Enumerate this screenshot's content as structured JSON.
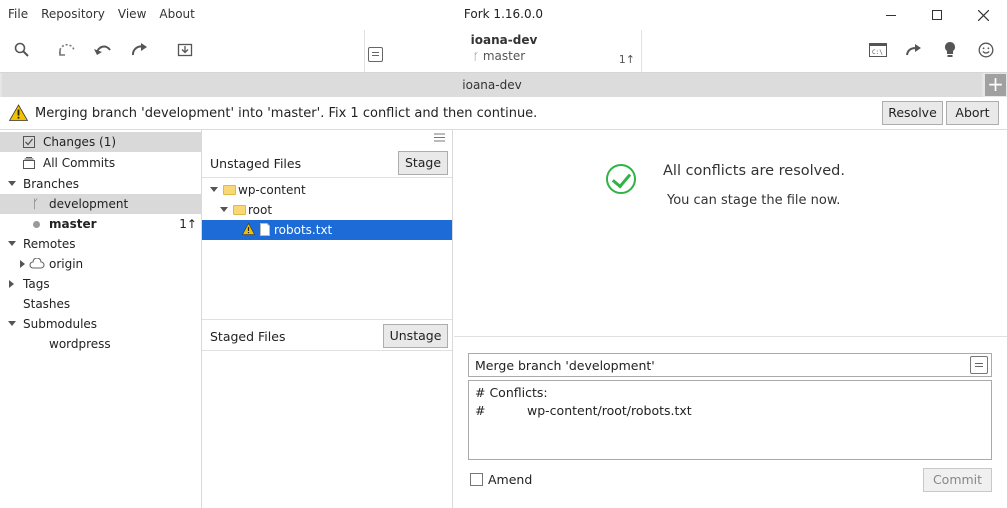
{
  "menu": [
    "File",
    "Repository",
    "View",
    "About"
  ],
  "app_title": "Fork 1.16.0.0",
  "toolbar": {
    "left_icons": [
      "search-icon",
      "fetch-icon",
      "pull-icon",
      "push-icon",
      "stash-icon"
    ],
    "right_icons": [
      "terminal-icon",
      "share-icon",
      "lightbulb-icon",
      "smiley-icon"
    ]
  },
  "repo": {
    "name": "ioana-dev",
    "branch": "master",
    "ahead": "1↑"
  },
  "tab": {
    "label": "ioana-dev"
  },
  "warning": {
    "text": "Merging branch 'development' into 'master'. Fix 1 conflict and then continue.",
    "resolve_label": "Resolve",
    "abort_label": "Abort"
  },
  "sidebar": {
    "changes": "Changes (1)",
    "all_commits": "All Commits",
    "branches": "Branches",
    "branch_items": [
      {
        "label": "development"
      },
      {
        "label": "master",
        "badge": "1↑"
      }
    ],
    "remotes": "Remotes",
    "remote_items": [
      "origin"
    ],
    "tags": "Tags",
    "stashes": "Stashes",
    "submodules": "Submodules",
    "submodule_items": [
      "wordpress"
    ]
  },
  "unstaged": {
    "title": "Unstaged Files",
    "stage_label": "Stage",
    "tree": [
      "wp-content",
      "root",
      "robots.txt"
    ]
  },
  "staged": {
    "title": "Staged Files",
    "unstage_label": "Unstage"
  },
  "status": {
    "title": "All conflicts are resolved.",
    "subtitle": "You can stage the file now."
  },
  "commit": {
    "summary": "Merge branch 'development'",
    "body_line1": "# Conflicts:",
    "body_line2_hash": "#",
    "body_line2_path": "wp-content/root/robots.txt",
    "amend_label": "Amend",
    "commit_label": "Commit"
  },
  "colors": {
    "selection": "#1c6bd6",
    "warning": "#f2c200",
    "success": "#2fb344"
  }
}
